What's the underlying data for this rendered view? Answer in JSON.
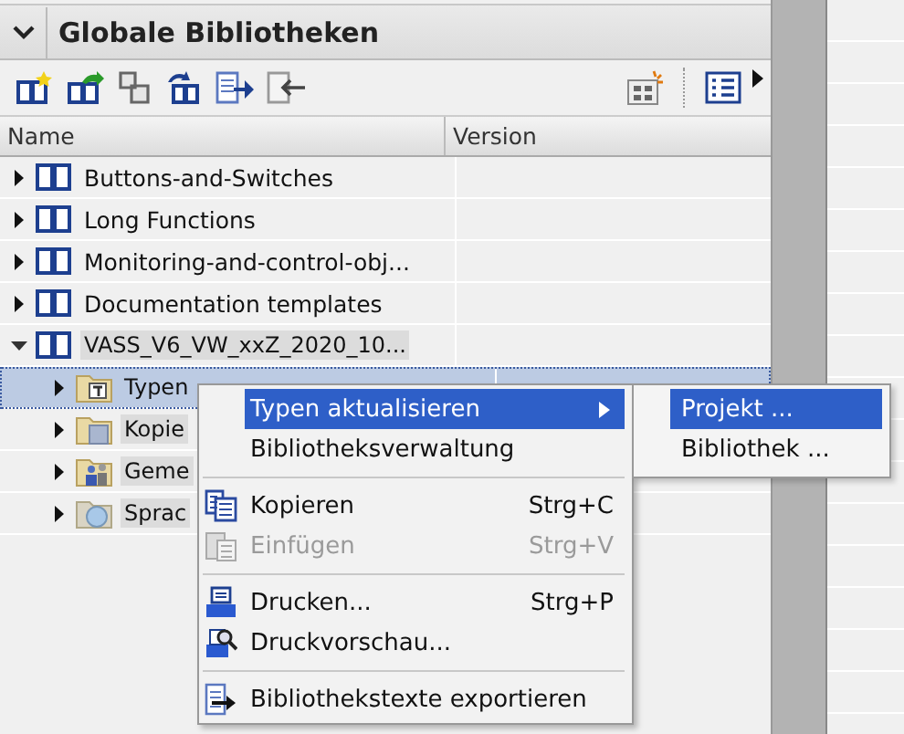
{
  "panel": {
    "title": "Globale Bibliotheken",
    "expanded": true
  },
  "table": {
    "columns": [
      "Name",
      "Version"
    ],
    "rows": [
      {
        "label": "Buttons-and-Switches",
        "expanded": false,
        "selected": false,
        "kind": "library"
      },
      {
        "label": "Long Functions",
        "expanded": false,
        "selected": false,
        "kind": "library"
      },
      {
        "label": "Monitoring-and-control-obj...",
        "expanded": false,
        "selected": false,
        "kind": "library"
      },
      {
        "label": "Documentation templates",
        "expanded": false,
        "selected": false,
        "kind": "library"
      },
      {
        "label": "VASS_V6_VW_xxZ_2020_10...",
        "expanded": true,
        "selected": false,
        "kind": "library",
        "children": [
          {
            "label": "Typen",
            "expanded": false,
            "selected": true,
            "kind": "types"
          },
          {
            "label": "Kopie",
            "expanded": false,
            "selected": false,
            "kind": "copies"
          },
          {
            "label": "Geme",
            "expanded": false,
            "selected": false,
            "kind": "shared"
          },
          {
            "label": "Sprac",
            "expanded": false,
            "selected": false,
            "kind": "language"
          }
        ]
      }
    ]
  },
  "context_menu": {
    "items": [
      {
        "kind": "plain",
        "label": "Typen aktualisieren",
        "selected": true,
        "disabled": false,
        "submenu": true
      },
      {
        "kind": "plain",
        "label": "Bibliotheksverwaltung",
        "selected": false,
        "disabled": false,
        "submenu": false
      },
      {
        "kind": "separator"
      },
      {
        "kind": "copy",
        "label": "Kopieren",
        "shortcut": "Strg+C",
        "selected": false,
        "disabled": false,
        "submenu": false
      },
      {
        "kind": "paste",
        "label": "Einfügen",
        "shortcut": "Strg+V",
        "selected": false,
        "disabled": true,
        "submenu": false
      },
      {
        "kind": "separator"
      },
      {
        "kind": "print",
        "label": "Drucken...",
        "shortcut": "Strg+P",
        "selected": false,
        "disabled": false,
        "submenu": false
      },
      {
        "kind": "preview",
        "label": "Druckvorschau...",
        "selected": false,
        "disabled": false,
        "submenu": false
      },
      {
        "kind": "separator"
      },
      {
        "kind": "export",
        "label": "Bibliothekstexte exportieren",
        "selected": false,
        "disabled": false,
        "submenu": false
      }
    ]
  },
  "submenu": {
    "items": [
      {
        "label": "Projekt ...",
        "selected": true
      },
      {
        "label": "Bibliothek ...",
        "selected": false
      }
    ]
  }
}
